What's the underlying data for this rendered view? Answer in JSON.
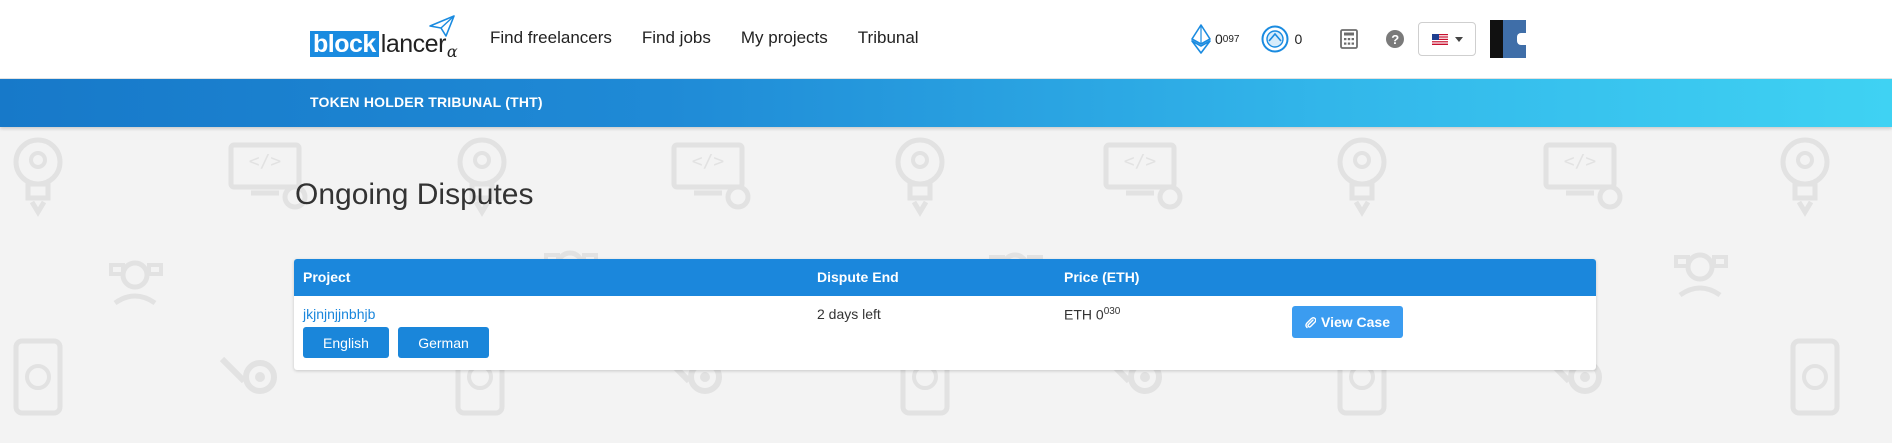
{
  "header": {
    "logo": {
      "block": "block",
      "lancer": "lancer",
      "alpha": "α"
    },
    "nav": [
      "Find freelancers",
      "Find jobs",
      "My projects",
      "Tribunal"
    ],
    "balances": {
      "eth": {
        "whole": "0",
        "sup": "097"
      },
      "token": {
        "value": "0"
      }
    },
    "language": "us-flag"
  },
  "banner": {
    "title": "TOKEN HOLDER TRIBUNAL (THT)"
  },
  "page": {
    "title": "Ongoing Disputes"
  },
  "table": {
    "headers": [
      "Project",
      "Dispute End",
      "Price (ETH)"
    ],
    "rows": [
      {
        "project": "jkjnjnjjnbhjb",
        "languages": [
          "English",
          "German"
        ],
        "dispute_end": "2 days left",
        "price": {
          "prefix": "ETH 0",
          "sup": "030"
        },
        "action": "View Case"
      }
    ]
  },
  "colors": {
    "brand_blue": "#1a8be0",
    "table_header": "#1b87dc",
    "button": "#1a86da",
    "view_button": "#3b9cf0"
  },
  "icons": [
    "ethereum-icon",
    "token-icon",
    "calculator-icon",
    "help-icon",
    "flag-us-icon",
    "caret-down-icon",
    "wallet-icon",
    "paperclip-icon"
  ]
}
